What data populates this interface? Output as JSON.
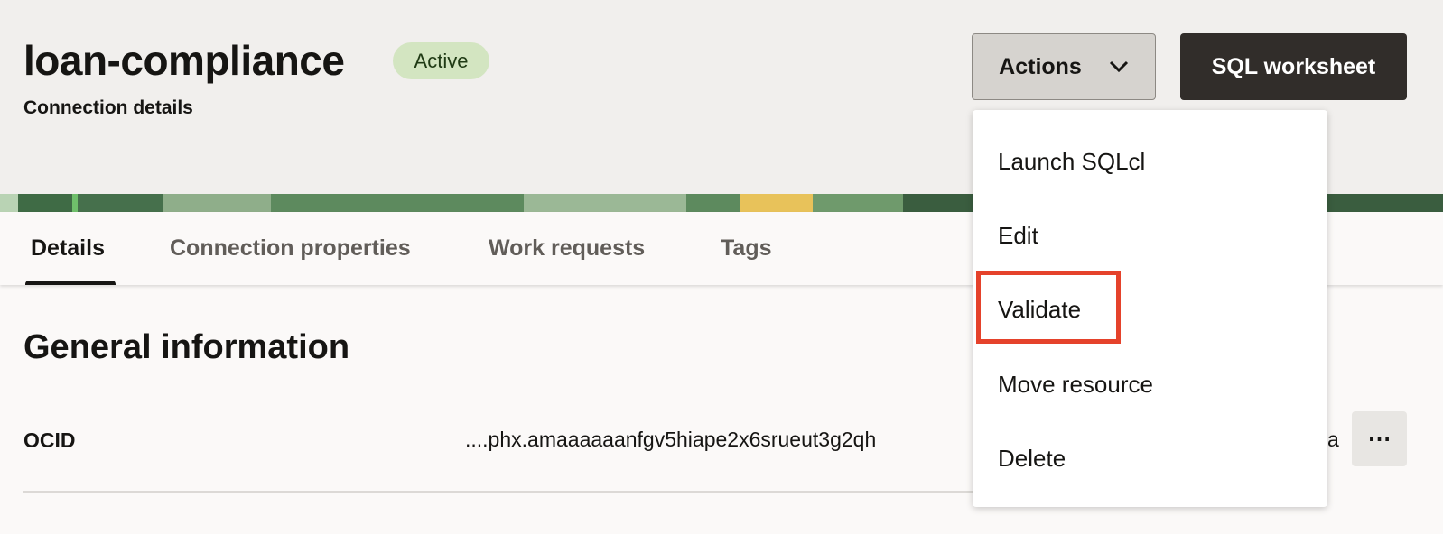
{
  "header": {
    "title": "loan-compliance",
    "status": "Active",
    "subtitle": "Connection details",
    "actions_label": "Actions",
    "sql_worksheet_label": "SQL worksheet"
  },
  "tabs": [
    {
      "label": "Details",
      "active": true
    },
    {
      "label": "Connection properties"
    },
    {
      "label": "Work requests"
    },
    {
      "label": "Tags"
    }
  ],
  "section": {
    "title": "General information",
    "ocid_label": "OCID",
    "ocid_value_visible": "....phx.amaaaaaanfgv5hiape2x6srueut3g2qh",
    "ocid_value_tail": "a",
    "more_label": "⋯"
  },
  "menu": {
    "items": [
      "Launch SQLcl",
      "Edit",
      "Validate",
      "Move resource",
      "Delete"
    ],
    "highlighted": "Validate"
  },
  "colors": {
    "highlight": "#e5422b",
    "badge": "#d3e5c1",
    "primary_button": "#312d2a"
  }
}
